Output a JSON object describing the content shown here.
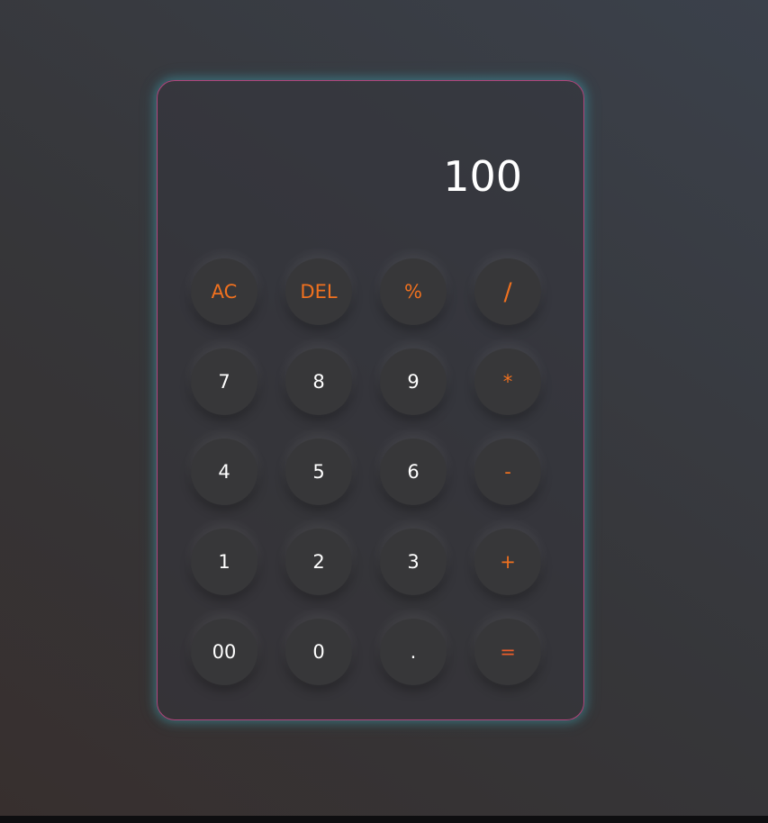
{
  "calculator": {
    "display_value": "100",
    "buttons": [
      {
        "label": "AC",
        "name": "all-clear-button",
        "kind": "op"
      },
      {
        "label": "DEL",
        "name": "delete-button",
        "kind": "op"
      },
      {
        "label": "%",
        "name": "percent-button",
        "kind": "op"
      },
      {
        "label": "/",
        "name": "divide-button",
        "kind": "op-big"
      },
      {
        "label": "7",
        "name": "digit-7-button",
        "kind": "num"
      },
      {
        "label": "8",
        "name": "digit-8-button",
        "kind": "num"
      },
      {
        "label": "9",
        "name": "digit-9-button",
        "kind": "num"
      },
      {
        "label": "*",
        "name": "multiply-button",
        "kind": "op"
      },
      {
        "label": "4",
        "name": "digit-4-button",
        "kind": "num"
      },
      {
        "label": "5",
        "name": "digit-5-button",
        "kind": "num"
      },
      {
        "label": "6",
        "name": "digit-6-button",
        "kind": "num"
      },
      {
        "label": "-",
        "name": "subtract-button",
        "kind": "op"
      },
      {
        "label": "1",
        "name": "digit-1-button",
        "kind": "num"
      },
      {
        "label": "2",
        "name": "digit-2-button",
        "kind": "num"
      },
      {
        "label": "3",
        "name": "digit-3-button",
        "kind": "num"
      },
      {
        "label": "+",
        "name": "add-button",
        "kind": "op"
      },
      {
        "label": "00",
        "name": "double-zero-button",
        "kind": "num"
      },
      {
        "label": "0",
        "name": "digit-0-button",
        "kind": "num"
      },
      {
        "label": ".",
        "name": "decimal-point-button",
        "kind": "num"
      },
      {
        "label": "=",
        "name": "equals-button",
        "kind": "eq"
      }
    ]
  },
  "colors": {
    "operator": "#f0711f",
    "equals": "#ea5d2a",
    "digit": "#ffffff",
    "border": "#b1447b",
    "glow": "#3eb2c4"
  }
}
